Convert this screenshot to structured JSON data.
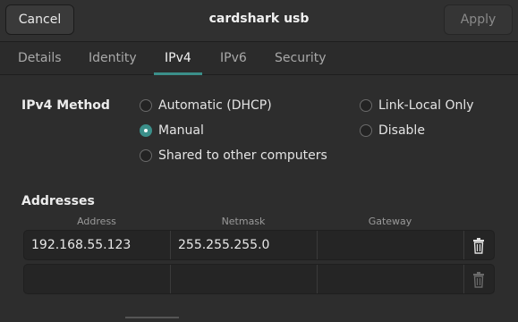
{
  "header": {
    "cancel_label": "Cancel",
    "title": "cardshark usb",
    "apply_label": "Apply"
  },
  "tabs": [
    {
      "label": "Details"
    },
    {
      "label": "Identity"
    },
    {
      "label": "IPv4"
    },
    {
      "label": "IPv6"
    },
    {
      "label": "Security"
    }
  ],
  "active_tab": "IPv4",
  "method": {
    "label": "IPv4 Method",
    "options": [
      {
        "label": "Automatic (DHCP)",
        "checked": false
      },
      {
        "label": "Manual",
        "checked": true
      },
      {
        "label": "Shared to other computers",
        "checked": false
      },
      {
        "label": "Link-Local Only",
        "checked": false
      },
      {
        "label": "Disable",
        "checked": false
      }
    ]
  },
  "addresses": {
    "label": "Addresses",
    "columns": [
      "Address",
      "Netmask",
      "Gateway"
    ],
    "rows": [
      {
        "address": "192.168.55.123",
        "netmask": "255.255.255.0",
        "gateway": ""
      },
      {
        "address": "",
        "netmask": "",
        "gateway": ""
      }
    ]
  },
  "colors": {
    "accent": "#3b8f8a",
    "background": "#2d2d2d"
  }
}
